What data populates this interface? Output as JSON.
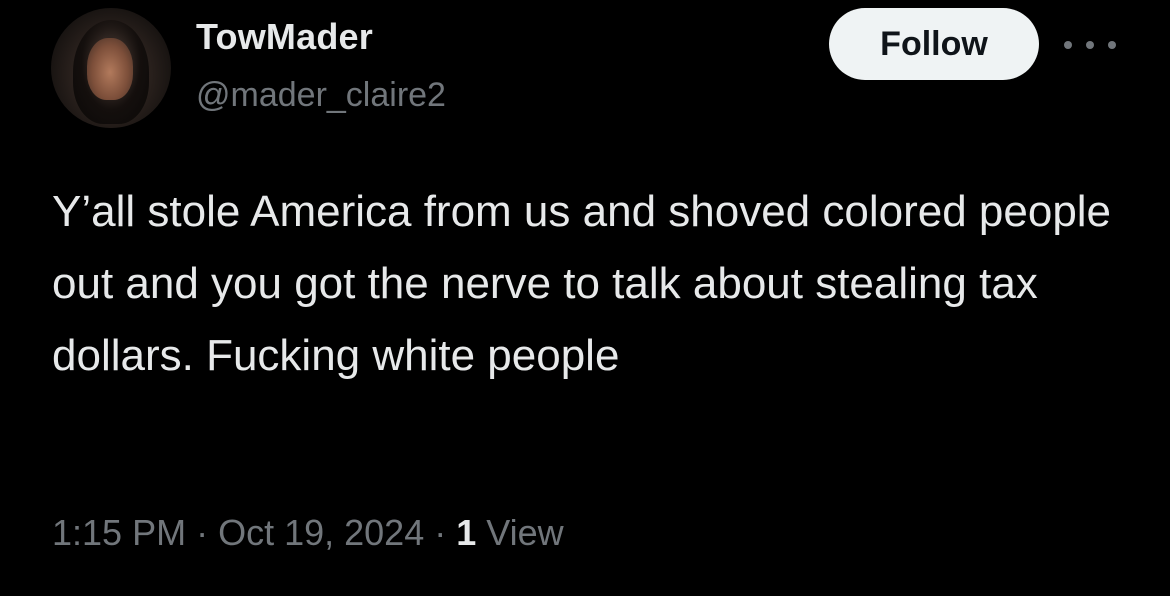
{
  "tweet": {
    "author": {
      "display_name": "TowMader",
      "handle": "@mader_claire2",
      "avatar": "profile-photo"
    },
    "follow_label": "Follow",
    "more_icon": "more-horizontal-icon",
    "text": "Y’all stole America from us and shoved colored people out and you got the nerve to talk about stealing tax dollars. Fucking white people",
    "time": "1:15 PM",
    "date": "Oct 19, 2024",
    "separator": "·",
    "views_count": "1",
    "views_label": "View"
  },
  "colors": {
    "background": "#000000",
    "primary_text": "#e7e9ea",
    "secondary_text": "#71767b",
    "follow_button_bg": "#eff3f4",
    "follow_button_text": "#0f1419"
  }
}
